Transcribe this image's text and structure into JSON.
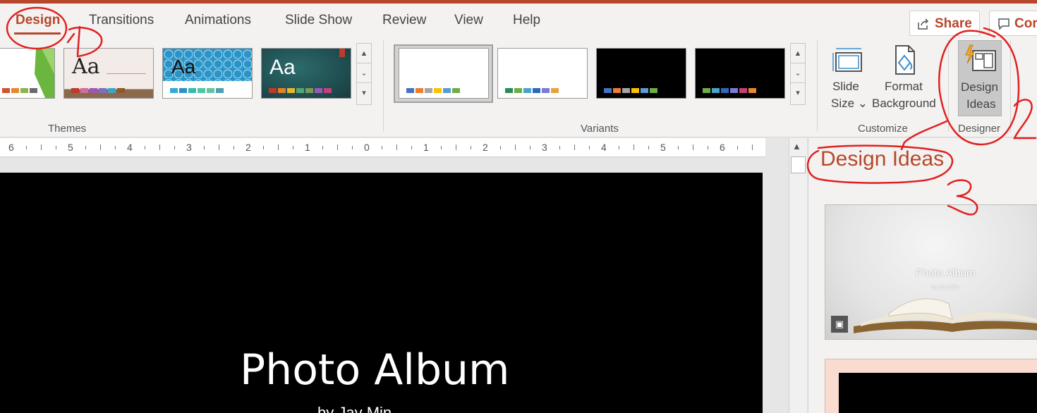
{
  "tabs": [
    {
      "label": "Design",
      "active": true
    },
    {
      "label": "Transitions"
    },
    {
      "label": "Animations"
    },
    {
      "label": "Slide Show"
    },
    {
      "label": "Review"
    },
    {
      "label": "View"
    },
    {
      "label": "Help"
    }
  ],
  "share_label": "Share",
  "comments_label": "Cor",
  "themes": {
    "group_label": "Themes",
    "thumbs": [
      {
        "text": "",
        "swatches": [
          "#d35230",
          "#e6892e",
          "#8cb34a",
          "#6b6b6b"
        ]
      },
      {
        "text": "Aa",
        "swatches": [
          "#c0392b",
          "#d36ba4",
          "#9b59b6",
          "#7b6fc9",
          "#3fa4c2",
          "#8b5a2b"
        ]
      },
      {
        "text": "Aa",
        "swatches": [
          "#36a9d6",
          "#2f8fc7",
          "#37b9b0",
          "#4ec4a8",
          "#66c3a1",
          "#4e9fb3"
        ]
      },
      {
        "text": "Aa",
        "swatches": [
          "#c0392b",
          "#e67e22",
          "#e6b830",
          "#58a47a",
          "#7a9a56",
          "#9b59b6",
          "#c2417a"
        ]
      }
    ]
  },
  "variants": {
    "group_label": "Variants",
    "thumbs": [
      {
        "bg": "#ffffff",
        "swatches": [
          "#4472c4",
          "#ed7d31",
          "#a5a5a5",
          "#ffc000",
          "#5b9bd5",
          "#70ad47"
        ]
      },
      {
        "bg": "#ffffff",
        "swatches": [
          "#2e8b57",
          "#70ad47",
          "#4aa3c9",
          "#2d6ab5",
          "#7b7bd5",
          "#e6a23a"
        ]
      },
      {
        "bg": "#000000",
        "swatches": [
          "#4472c4",
          "#ed7d31",
          "#a5a5a5",
          "#ffc000",
          "#5b9bd5",
          "#70ad47"
        ]
      },
      {
        "bg": "#000000",
        "swatches": [
          "#70ad47",
          "#4aa3c9",
          "#2d6ab5",
          "#7b7bd5",
          "#c2417a",
          "#e6892e"
        ]
      }
    ]
  },
  "customize": {
    "group_label": "Customize",
    "slide_size_line1": "Slide",
    "slide_size_line2": "Size ⌄",
    "format_bg_line1": "Format",
    "format_bg_line2": "Background"
  },
  "designer": {
    "group_label": "Designer",
    "design_ideas_line1": "Design",
    "design_ideas_line2": "Ideas"
  },
  "ruler_labels": [
    "6",
    "5",
    "4",
    "3",
    "2",
    "1",
    "0",
    "1",
    "2",
    "3",
    "4",
    "5",
    "6"
  ],
  "slide": {
    "title": "Photo Album",
    "subtitle": "by Jay Min"
  },
  "pane": {
    "title": "Design Ideas",
    "idea1_title": "Photo Album",
    "idea1_subtitle": "by Jay Min"
  },
  "annotations": [
    "1",
    "2",
    "3"
  ],
  "colors": {
    "accent": "#b7472a",
    "annotation": "#e02020"
  }
}
